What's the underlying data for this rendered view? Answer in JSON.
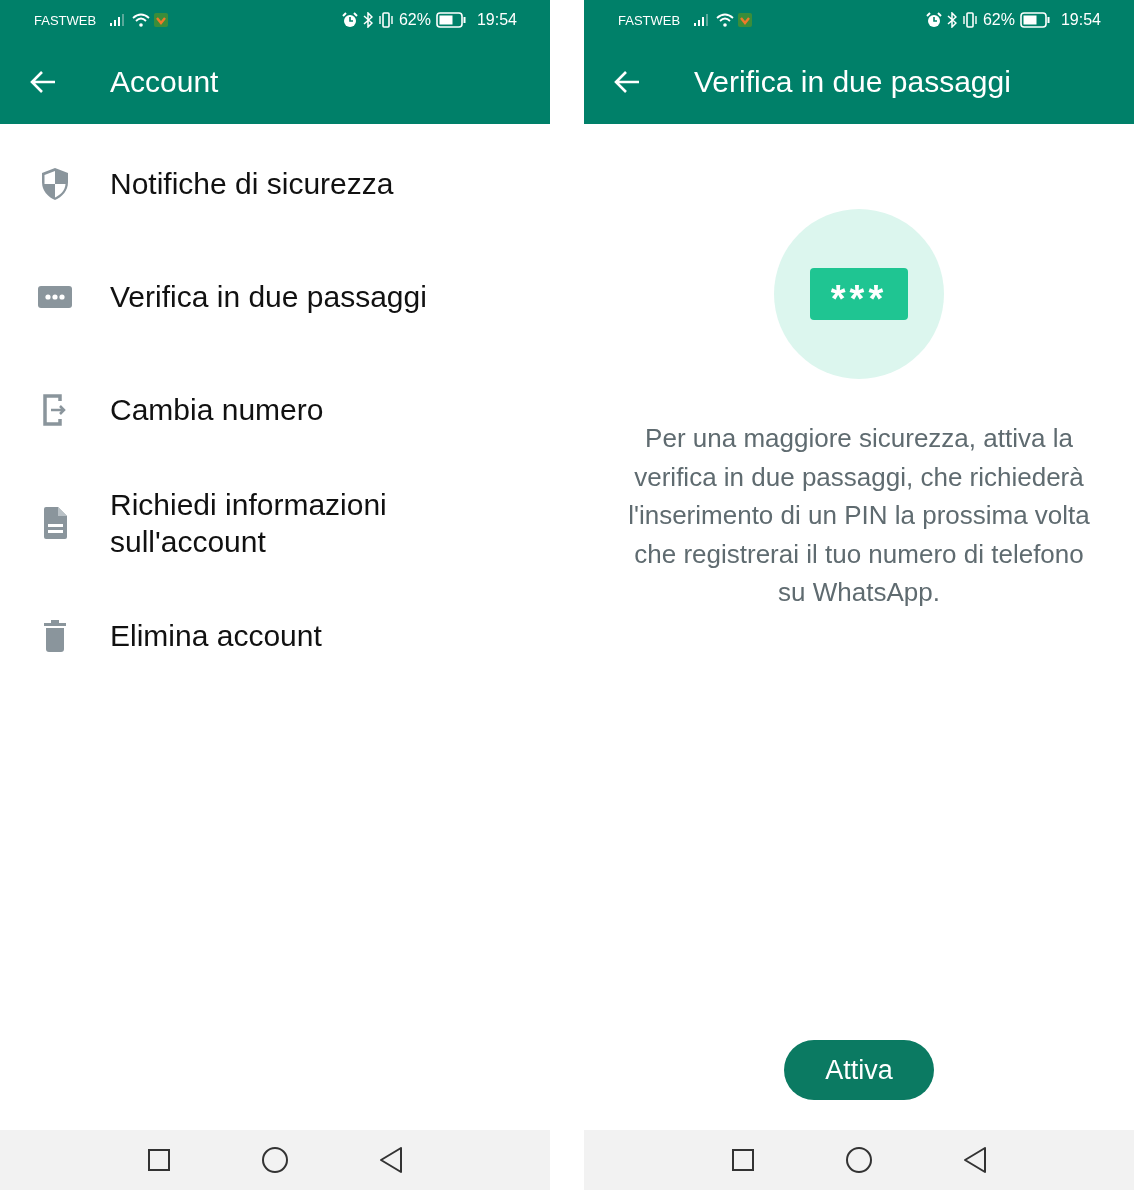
{
  "screens": [
    {
      "kind": "menu",
      "status_bar": {
        "carrier": "FASTWEB",
        "battery": "62%",
        "time": "19:54"
      },
      "title": "Account",
      "items": [
        {
          "label": "Notifiche di sicurezza"
        },
        {
          "label": "Verifica in due passaggi"
        },
        {
          "label": "Cambia numero"
        },
        {
          "label": "Richiedi informazioni sull'account"
        },
        {
          "label": "Elimina account"
        }
      ]
    },
    {
      "kind": "info",
      "status_bar": {
        "carrier": "FASTWEB",
        "battery": "62%",
        "time": "19:54"
      },
      "title": "Verifica in due passaggi",
      "badge": "***",
      "text": "Per una maggiore sicurezza, attiva la verifica in due passaggi, che richiederà l'inserimento di un PIN la prossima volta che registrerai il tuo numero di telefono su WhatsApp.",
      "button": "Attiva"
    }
  ]
}
